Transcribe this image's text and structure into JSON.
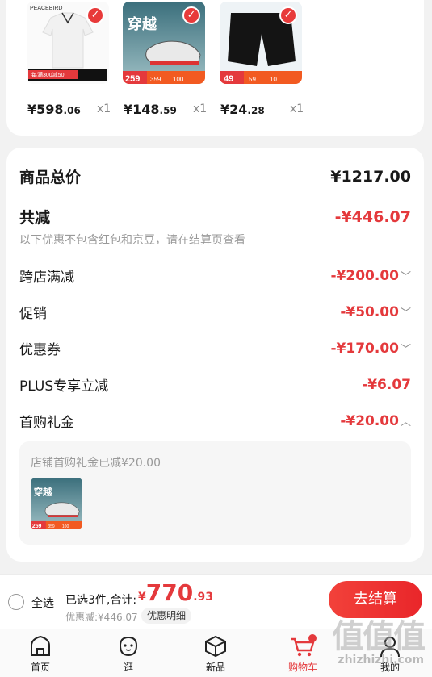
{
  "products": [
    {
      "price_int": "¥598",
      "price_dec": ".06",
      "qty": "x1",
      "brand": "PEACEBIRD",
      "tag": "每满300减50"
    },
    {
      "price_int": "¥148",
      "price_dec": ".59",
      "qty": "x1",
      "title": "穿越",
      "tag_a": "259",
      "tag_b": "359",
      "tag_c": "100"
    },
    {
      "price_int": "¥24",
      "price_dec": ".28",
      "qty": "x1",
      "tag_a": "49",
      "tag_b": "59",
      "tag_c": "10"
    }
  ],
  "summary": {
    "total_label": "商品总价",
    "total_value": "¥1217.00",
    "discount_label": "共减",
    "discount_value": "-¥446.07",
    "discount_note": "以下优惠不包含红包和京豆，请在结算页查看",
    "cross_store_label": "跨店满减",
    "cross_store_value": "-¥200.00",
    "promo_label": "促销",
    "promo_value": "-¥50.00",
    "coupon_label": "优惠券",
    "coupon_value": "-¥170.00",
    "plus_label": "PLUS专享立减",
    "plus_value": "-¥6.07",
    "first_gift_label": "首购礼金",
    "first_gift_value": "-¥20.00",
    "first_gift_detail": "店铺首购礼金已减¥20.00",
    "chevron_down": "﹀",
    "chevron_up": "︿"
  },
  "checkout": {
    "select_all": "全选",
    "selected_count": "已选3件,合计:",
    "currency": "¥",
    "total_int": "770",
    "total_dec": ".93",
    "saved": "优惠减:¥446.07",
    "detail_button": "优惠明细",
    "pay_button": "去结算"
  },
  "tabs": [
    {
      "label": "首页",
      "icon": "home-icon"
    },
    {
      "label": "逛",
      "icon": "explore-icon"
    },
    {
      "label": "新品",
      "icon": "cube-icon"
    },
    {
      "label": "购物车",
      "icon": "cart-icon"
    },
    {
      "label": "我的",
      "icon": "user-icon"
    }
  ],
  "watermark": {
    "main": "值值值",
    "sub": "zhizhizhi.com"
  },
  "colors": {
    "accent": "#e4393c",
    "background": "#f2f2f2"
  }
}
